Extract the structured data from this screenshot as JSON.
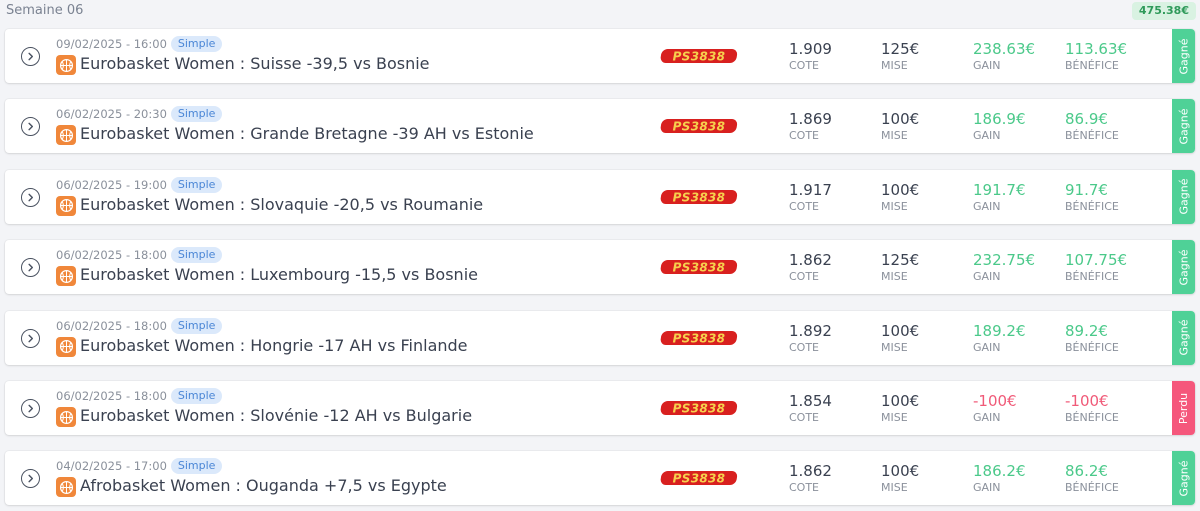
{
  "week": {
    "title": "Semaine 06",
    "total": "475.38€"
  },
  "labels": {
    "cote": "COTE",
    "mise": "MISE",
    "gain": "GAIN",
    "benefice": "BÉNÉFICE"
  },
  "bookmaker": "PS3838",
  "bets": [
    {
      "date": "09/02/2025 - 16:00",
      "type": "Simple",
      "event": "Eurobasket Women : Suisse -39,5 vs Bosnie",
      "cote": "1.909",
      "mise": "125€",
      "gain": "238.63€",
      "benefice": "113.63€",
      "status": "Gagné",
      "outcome": "won"
    },
    {
      "date": "06/02/2025 - 20:30",
      "type": "Simple",
      "event": "Eurobasket Women : Grande Bretagne -39 AH vs Estonie",
      "cote": "1.869",
      "mise": "100€",
      "gain": "186.9€",
      "benefice": "86.9€",
      "status": "Gagné",
      "outcome": "won"
    },
    {
      "date": "06/02/2025 - 19:00",
      "type": "Simple",
      "event": "Eurobasket Women : Slovaquie -20,5 vs Roumanie",
      "cote": "1.917",
      "mise": "100€",
      "gain": "191.7€",
      "benefice": "91.7€",
      "status": "Gagné",
      "outcome": "won"
    },
    {
      "date": "06/02/2025 - 18:00",
      "type": "Simple",
      "event": "Eurobasket Women : Luxembourg -15,5 vs Bosnie",
      "cote": "1.862",
      "mise": "125€",
      "gain": "232.75€",
      "benefice": "107.75€",
      "status": "Gagné",
      "outcome": "won"
    },
    {
      "date": "06/02/2025 - 18:00",
      "type": "Simple",
      "event": "Eurobasket Women : Hongrie -17 AH vs Finlande",
      "cote": "1.892",
      "mise": "100€",
      "gain": "189.2€",
      "benefice": "89.2€",
      "status": "Gagné",
      "outcome": "won"
    },
    {
      "date": "06/02/2025 - 18:00",
      "type": "Simple",
      "event": "Eurobasket Women : Slovénie -12 AH vs Bulgarie",
      "cote": "1.854",
      "mise": "100€",
      "gain": "-100€",
      "benefice": "-100€",
      "status": "Perdu",
      "outcome": "lost"
    },
    {
      "date": "04/02/2025 - 17:00",
      "type": "Simple",
      "event": "Afrobasket Women : Ouganda +7,5 vs Egypte",
      "cote": "1.862",
      "mise": "100€",
      "gain": "186.2€",
      "benefice": "86.2€",
      "status": "Gagné",
      "outcome": "won"
    }
  ],
  "icons": {
    "expand": "chevron-right-circle-icon",
    "sport": "basketball-icon"
  },
  "colors": {
    "won": "#4fd197",
    "lost": "#f5577c",
    "positive_text": "#4bc98a",
    "negative_text": "#f05a78",
    "bookmaker_red": "#d8201f",
    "bookmaker_yellow": "#f6d04d"
  }
}
